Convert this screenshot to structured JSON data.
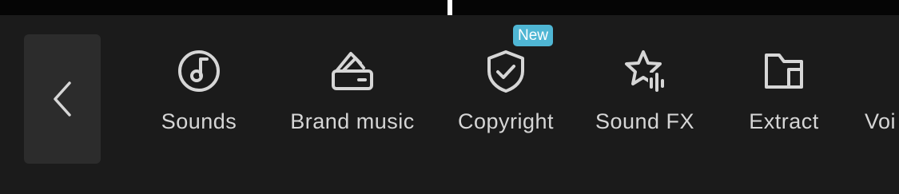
{
  "toolbar": {
    "back": {
      "icon": "chevron-left-icon"
    },
    "items": [
      {
        "label": "Sounds",
        "icon": "music-note-circle-icon"
      },
      {
        "label": "Brand music",
        "icon": "brand-folder-icon"
      },
      {
        "label": "Copyright",
        "icon": "shield-check-icon",
        "badge": "New"
      },
      {
        "label": "Sound FX",
        "icon": "star-waveform-icon"
      },
      {
        "label": "Extract",
        "icon": "folder-extract-icon"
      },
      {
        "label": "Voi",
        "icon": "voice-icon"
      }
    ]
  },
  "colors": {
    "background": "#1b1b1b",
    "top_strip": "#050505",
    "back_button": "#2c2c2c",
    "text": "#d6d6d6",
    "icon": "#d6d6d6",
    "badge": "#4fb6d4"
  }
}
